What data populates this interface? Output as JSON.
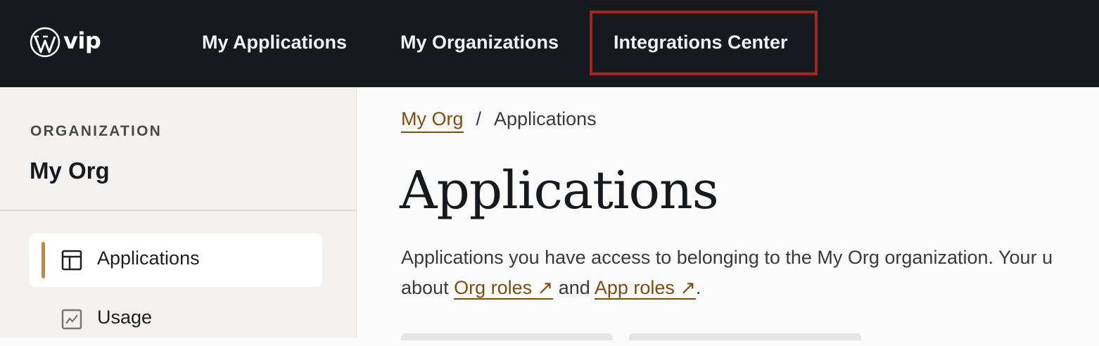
{
  "header": {
    "logo_text": "vip",
    "nav": [
      {
        "label": "My Applications"
      },
      {
        "label": "My Organizations"
      },
      {
        "label": "Integrations Center"
      }
    ]
  },
  "sidebar": {
    "section_label": "ORGANIZATION",
    "org_name": "My Org",
    "items": [
      {
        "label": "Applications",
        "icon": "layout-icon",
        "active": true
      },
      {
        "label": "Usage",
        "icon": "chart-icon",
        "active": false
      }
    ]
  },
  "main": {
    "breadcrumb": {
      "parent": "My Org",
      "separator": "/",
      "current": "Applications"
    },
    "title": "Applications",
    "description_line1": "Applications you have access to belonging to the My Org organization. Your u",
    "description_line2_prefix": "about ",
    "org_roles_link": "Org roles ↗",
    "and_text": " and ",
    "app_roles_link": "App roles ↗",
    "description_end": "."
  },
  "colors": {
    "topbar": "#161a1e",
    "highlight": "#a3271e",
    "link": "#7c4d12",
    "accent": "#c08a3e"
  }
}
